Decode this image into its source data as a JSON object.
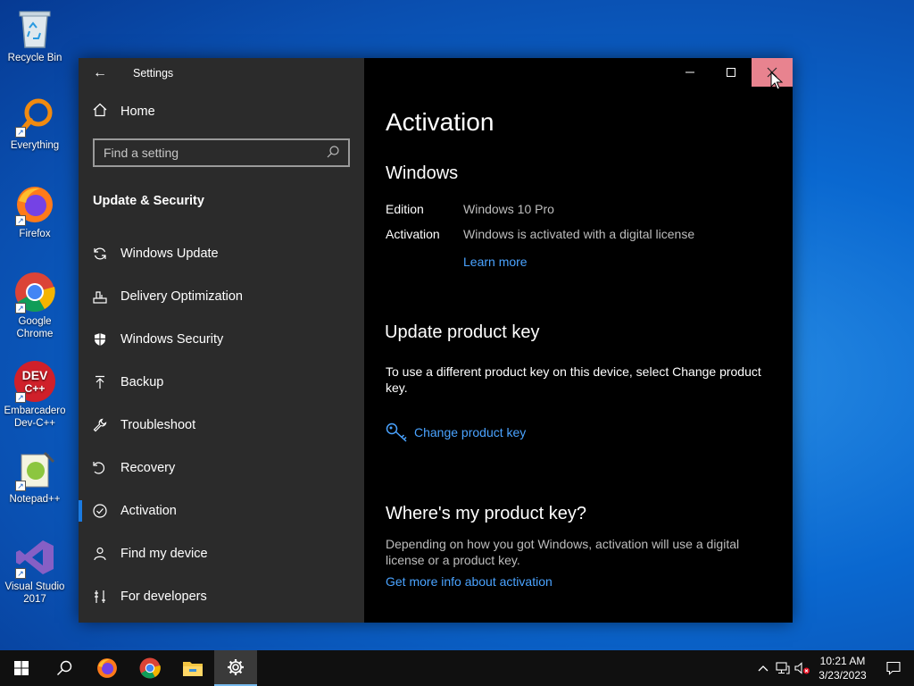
{
  "desktop": {
    "icons": [
      {
        "label": "Recycle Bin"
      },
      {
        "label": "Everything"
      },
      {
        "label": "Firefox"
      },
      {
        "label": "Google Chrome"
      },
      {
        "label": "Embarcadero Dev-C++"
      },
      {
        "label": "Notepad++"
      },
      {
        "label": "Visual Studio 2017"
      }
    ]
  },
  "window": {
    "title": "Settings",
    "controls": {
      "minimize": "—",
      "maximize": "☐",
      "close": "✕"
    }
  },
  "sidebar": {
    "home_label": "Home",
    "search_placeholder": "Find a setting",
    "section_title": "Update & Security",
    "items": [
      {
        "label": "Windows Update",
        "icon": "sync-icon"
      },
      {
        "label": "Delivery Optimization",
        "icon": "delivery-icon"
      },
      {
        "label": "Windows Security",
        "icon": "shield-icon"
      },
      {
        "label": "Backup",
        "icon": "backup-icon"
      },
      {
        "label": "Troubleshoot",
        "icon": "wrench-icon"
      },
      {
        "label": "Recovery",
        "icon": "recovery-icon"
      },
      {
        "label": "Activation",
        "icon": "check-circle-icon",
        "active": true
      },
      {
        "label": "Find my device",
        "icon": "person-pin-icon"
      },
      {
        "label": "For developers",
        "icon": "developer-icon"
      }
    ]
  },
  "main": {
    "page_title": "Activation",
    "windows_heading": "Windows",
    "edition_label": "Edition",
    "edition_value": "Windows 10 Pro",
    "activation_label": "Activation",
    "activation_value": "Windows is activated with a digital license",
    "learn_more": "Learn more",
    "update_key_heading": "Update product key",
    "update_key_text": "To use a different product key on this device, select Change product key.",
    "change_key_link": "Change product key",
    "where_heading": "Where's my product key?",
    "where_text": "Depending on how you got Windows, activation will use a digital license or a product key.",
    "more_info_link": "Get more info about activation"
  },
  "taskbar": {
    "time": "10:21 AM",
    "date": "3/23/2023"
  },
  "colors": {
    "accent": "#1a7ae0",
    "link": "#4aa3ff",
    "sidebar_bg": "#2b2b2b",
    "content_bg": "#000000",
    "close_hover": "#e8838f"
  }
}
